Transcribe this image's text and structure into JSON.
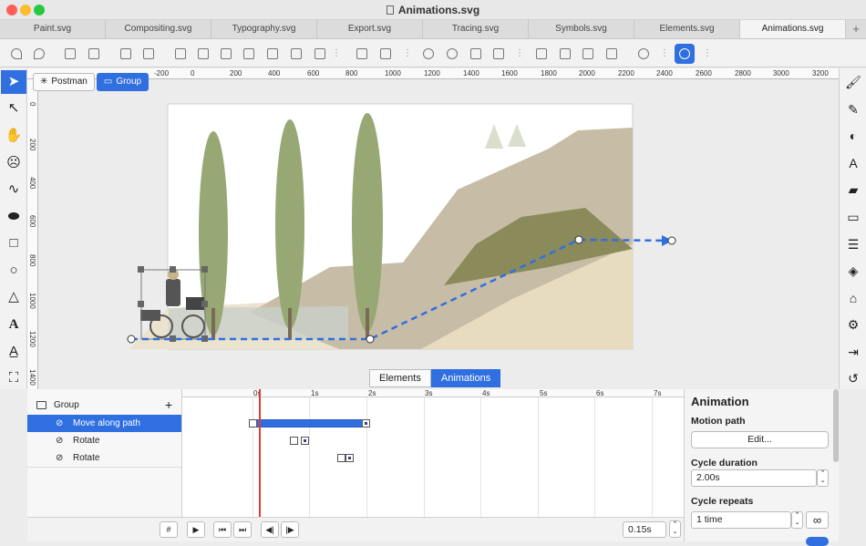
{
  "window": {
    "title": "Animations.svg"
  },
  "tabs": [
    {
      "label": "Paint.svg"
    },
    {
      "label": "Compositing.svg"
    },
    {
      "label": "Typography.svg"
    },
    {
      "label": "Export.svg"
    },
    {
      "label": "Tracing.svg"
    },
    {
      "label": "Symbols.svg"
    },
    {
      "label": "Elements.svg"
    },
    {
      "label": "Animations.svg",
      "active": true
    }
  ],
  "tab_add": "+",
  "ruler": {
    "h_ticks": [
      "-200",
      "0",
      "200",
      "400",
      "600",
      "800",
      "1000",
      "1200",
      "1400",
      "1600",
      "1800",
      "2000",
      "2200",
      "2400",
      "2600",
      "2800",
      "3000",
      "3200"
    ],
    "v_ticks": [
      "0",
      "200",
      "400",
      "600",
      "800",
      "1000",
      "1200",
      "1400"
    ]
  },
  "breadcrumb": {
    "postman": "Postman",
    "group": "Group"
  },
  "panel_tabs": {
    "elements": "Elements",
    "animations": "Animations"
  },
  "layers": {
    "group": "Group",
    "add": "+",
    "items": [
      {
        "label": "Move along path",
        "selected": true
      },
      {
        "label": "Rotate"
      },
      {
        "label": "Rotate"
      }
    ]
  },
  "timeline": {
    "ticks": [
      "0s",
      "1s",
      "2s",
      "3s",
      "4s",
      "5s",
      "6s",
      "7s"
    ]
  },
  "footer": {
    "grid_symbol": "#",
    "step_value": "0.15s"
  },
  "properties": {
    "heading": "Animation",
    "motion_path_label": "Motion path",
    "edit_button": "Edit...",
    "cycle_duration_label": "Cycle duration",
    "cycle_duration_value": "2.00s",
    "cycle_repeats_label": "Cycle repeats",
    "cycle_repeats_value": "1 time",
    "infinity_symbol": "∞"
  },
  "colors": {
    "accent": "#2f6fe0",
    "playhead": "#e03b3b"
  }
}
